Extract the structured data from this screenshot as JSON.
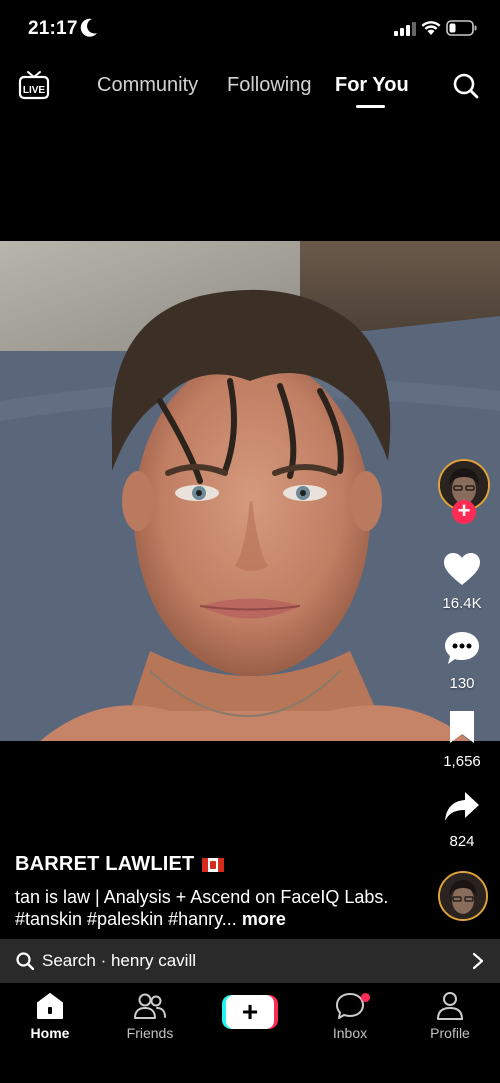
{
  "status_bar": {
    "time": "21:17",
    "moon_icon": "moon-icon",
    "signal_icon": "cellular-signal-icon",
    "wifi_icon": "wifi-icon",
    "battery_icon": "battery-icon"
  },
  "top_nav": {
    "live_label": "LIVE",
    "tabs": [
      {
        "label": "Community",
        "active": false
      },
      {
        "label": "Following",
        "active": false
      },
      {
        "label": "For You",
        "active": true
      }
    ],
    "search_icon": "search-icon"
  },
  "video": {
    "subject": "selfie portrait video"
  },
  "actions": {
    "likes": "16.4K",
    "comments": "130",
    "saves": "1,656",
    "shares": "824"
  },
  "caption": {
    "author": "BARRET LAWLIET",
    "author_flag": "canada-flag-icon",
    "text": "tan is law | Analysis + Ascend on FaceIQ Labs. #tanskin #paleskin #hanry...",
    "more": "more"
  },
  "search_bar": {
    "label": "Search · henry cavill"
  },
  "bottom_nav": {
    "items": [
      {
        "label": "Home",
        "icon": "home-icon",
        "active": true
      },
      {
        "label": "Friends",
        "icon": "friends-icon",
        "active": false
      },
      {
        "label": "",
        "icon": "create-plus-icon",
        "active": false
      },
      {
        "label": "Inbox",
        "icon": "inbox-icon",
        "active": false
      },
      {
        "label": "Profile",
        "icon": "profile-icon",
        "active": false
      }
    ]
  },
  "colors": {
    "accent_red": "#fe2c55",
    "accent_cyan": "#25f4ee",
    "background": "#000000",
    "search_bar_bg": "#2a2a2a"
  }
}
